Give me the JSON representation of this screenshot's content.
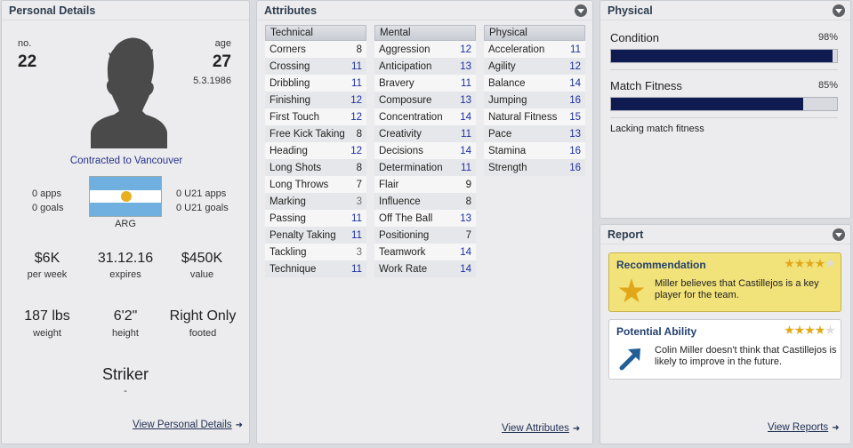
{
  "personal": {
    "title": "Personal Details",
    "no_label": "no.",
    "no_value": "22",
    "age_label": "age",
    "age_value": "27",
    "dob": "5.3.1986",
    "contract": "Contracted to Vancouver",
    "apps": "0 apps",
    "goals": "0 goals",
    "u21_apps": "0 U21 apps",
    "u21_goals": "0 U21 goals",
    "nation": "ARG",
    "wage_value": "$6K",
    "wage_label": "per week",
    "expires_value": "31.12.16",
    "expires_label": "expires",
    "value_value": "$450K",
    "value_label": "value",
    "weight_value": "187 lbs",
    "weight_label": "weight",
    "height_value": "6'2\"",
    "height_label": "height",
    "footed_value": "Right Only",
    "footed_label": "footed",
    "position": "Striker",
    "position_sub": "-",
    "link": "View Personal Details"
  },
  "attributes": {
    "title": "Attributes",
    "link": "View Attributes",
    "columns": [
      {
        "header": "Technical",
        "rows": [
          {
            "name": "Corners",
            "value": "8"
          },
          {
            "name": "Crossing",
            "value": "11"
          },
          {
            "name": "Dribbling",
            "value": "11"
          },
          {
            "name": "Finishing",
            "value": "12"
          },
          {
            "name": "First Touch",
            "value": "12"
          },
          {
            "name": "Free Kick Taking",
            "value": "8"
          },
          {
            "name": "Heading",
            "value": "12"
          },
          {
            "name": "Long Shots",
            "value": "8"
          },
          {
            "name": "Long Throws",
            "value": "7"
          },
          {
            "name": "Marking",
            "value": "3"
          },
          {
            "name": "Passing",
            "value": "11"
          },
          {
            "name": "Penalty Taking",
            "value": "11"
          },
          {
            "name": "Tackling",
            "value": "3"
          },
          {
            "name": "Technique",
            "value": "11"
          }
        ]
      },
      {
        "header": "Mental",
        "rows": [
          {
            "name": "Aggression",
            "value": "12"
          },
          {
            "name": "Anticipation",
            "value": "13"
          },
          {
            "name": "Bravery",
            "value": "11"
          },
          {
            "name": "Composure",
            "value": "13"
          },
          {
            "name": "Concentration",
            "value": "14"
          },
          {
            "name": "Creativity",
            "value": "11"
          },
          {
            "name": "Decisions",
            "value": "14"
          },
          {
            "name": "Determination",
            "value": "11"
          },
          {
            "name": "Flair",
            "value": "9"
          },
          {
            "name": "Influence",
            "value": "8"
          },
          {
            "name": "Off The Ball",
            "value": "13"
          },
          {
            "name": "Positioning",
            "value": "7"
          },
          {
            "name": "Teamwork",
            "value": "14"
          },
          {
            "name": "Work Rate",
            "value": "14"
          }
        ]
      },
      {
        "header": "Physical",
        "rows": [
          {
            "name": "Acceleration",
            "value": "11"
          },
          {
            "name": "Agility",
            "value": "12"
          },
          {
            "name": "Balance",
            "value": "14"
          },
          {
            "name": "Jumping",
            "value": "16"
          },
          {
            "name": "Natural Fitness",
            "value": "15"
          },
          {
            "name": "Pace",
            "value": "13"
          },
          {
            "name": "Stamina",
            "value": "16"
          },
          {
            "name": "Strength",
            "value": "16"
          }
        ]
      }
    ]
  },
  "physical": {
    "title": "Physical",
    "condition_label": "Condition",
    "condition_pct": "98%",
    "condition_fraction": 0.98,
    "fitness_label": "Match Fitness",
    "fitness_pct": "85%",
    "fitness_fraction": 0.85,
    "note": "Lacking match fitness"
  },
  "report": {
    "title": "Report",
    "link": "View Reports",
    "recommendation_title": "Recommendation",
    "recommendation_stars": 4,
    "recommendation_text": "Miller believes that Castillejos is a key player for the team.",
    "potential_title": "Potential Ability",
    "potential_stars": 4,
    "potential_text": "Colin Miller doesn't think that Castillejos is likely to improve in the future."
  },
  "colors": {
    "accent_navy": "#0f1b50",
    "value_blue": "#1a2fa0",
    "recommendation_bg": "#f2e27a"
  }
}
